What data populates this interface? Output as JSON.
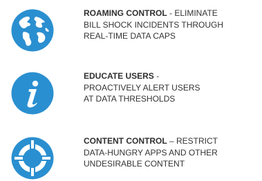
{
  "colors": {
    "icon_blue": "#2a8fd0",
    "text": "#333333"
  },
  "features": [
    {
      "icon": "globe-icon",
      "title": "ROAMING CONTROL",
      "sep": " - ",
      "line1_rest": "ELIMINATE",
      "line2": "BILL SHOCK INCIDENTS THROUGH",
      "line3": "REAL-TIME DATA CAPS"
    },
    {
      "icon": "info-icon",
      "title": "EDUCATE USERS",
      "sep": " -",
      "line1_rest": "",
      "line2": "PROACTIVELY ALERT USERS",
      "line3": "AT DATA THRESHOLDS"
    },
    {
      "icon": "crosshair-icon",
      "title": "CONTENT CONTROL",
      "sep": " – ",
      "line1_rest": "RESTRICT",
      "line2": "DATA-HUNGRY APPS AND OTHER",
      "line3": "UNDESIRABLE CONTENT"
    }
  ]
}
